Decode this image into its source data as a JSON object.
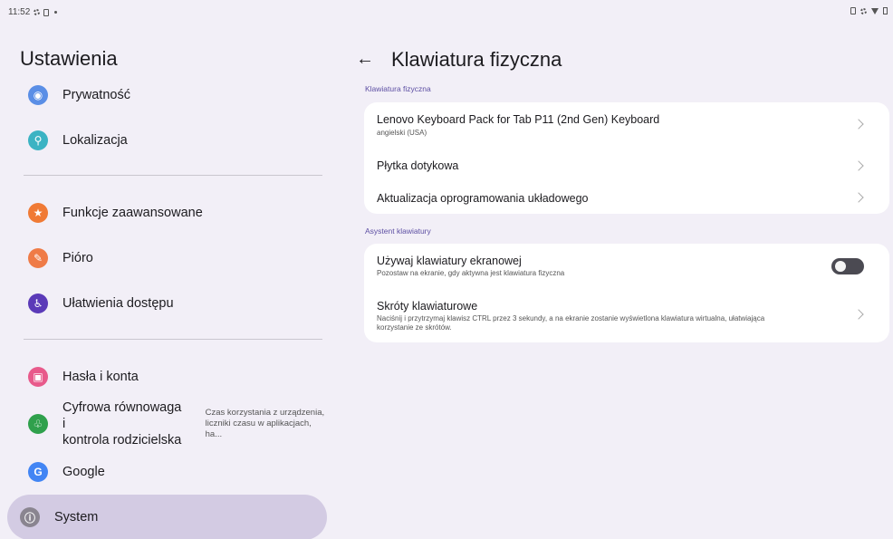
{
  "status_bar": {
    "time": "11:52"
  },
  "left": {
    "title": "Ustawienia",
    "items": [
      {
        "label": "Prywatność",
        "icon": "privacy-icon",
        "color": "#5a8ee6"
      },
      {
        "label": "Lokalizacja",
        "icon": "location-icon",
        "color": "#3bb3c3"
      },
      {
        "label": "Funkcje zaawansowane",
        "icon": "star-icon",
        "color": "#f07a35"
      },
      {
        "label": "Pióro",
        "icon": "pen-icon",
        "color": "#ef7b47"
      },
      {
        "label": "Ułatwienia dostępu",
        "icon": "accessibility-icon",
        "color": "#5b3ab8"
      },
      {
        "label": "Hasła i konta",
        "icon": "account-icon",
        "color": "#e85a8b"
      },
      {
        "label_line1": "Cyfrowa równowaga i",
        "label_line2": "kontrola rodzicielska",
        "sub_line1": "Czas korzystania z urządzenia,",
        "sub_line2": "liczniki czasu w aplikacjach, ha...",
        "icon": "wellbeing-icon",
        "color": "#2fa04c"
      },
      {
        "label": "Google",
        "icon": "google-icon",
        "color": "#4285f4"
      },
      {
        "label": "System",
        "icon": "system-icon",
        "color": "#8a8590"
      }
    ]
  },
  "right": {
    "title": "Klawiatura fizyczna",
    "sections": [
      {
        "label": "Klawiatura fizyczna",
        "rows": [
          {
            "title": "Lenovo Keyboard Pack for Tab P11 (2nd Gen) Keyboard",
            "desc": "angielski (USA)"
          },
          {
            "title": "Płytka dotykowa"
          },
          {
            "title": "Aktualizacja oprogramowania układowego"
          }
        ]
      },
      {
        "label": "Asystent klawiatury",
        "rows": [
          {
            "title": "Używaj klawiatury ekranowej",
            "desc": "Pozostaw na ekranie, gdy aktywna jest klawiatura fizyczna",
            "toggle_on": false
          },
          {
            "title": "Skróty klawiaturowe",
            "desc_line1": "Naciśnij i przytrzymaj klawisz CTRL przez 3 sekundy, a na ekranie zostanie wyświetlona klawiatura wirtualna, ułatwiająca",
            "desc_line2": "korzystanie ze skrótów."
          }
        ]
      }
    ]
  }
}
